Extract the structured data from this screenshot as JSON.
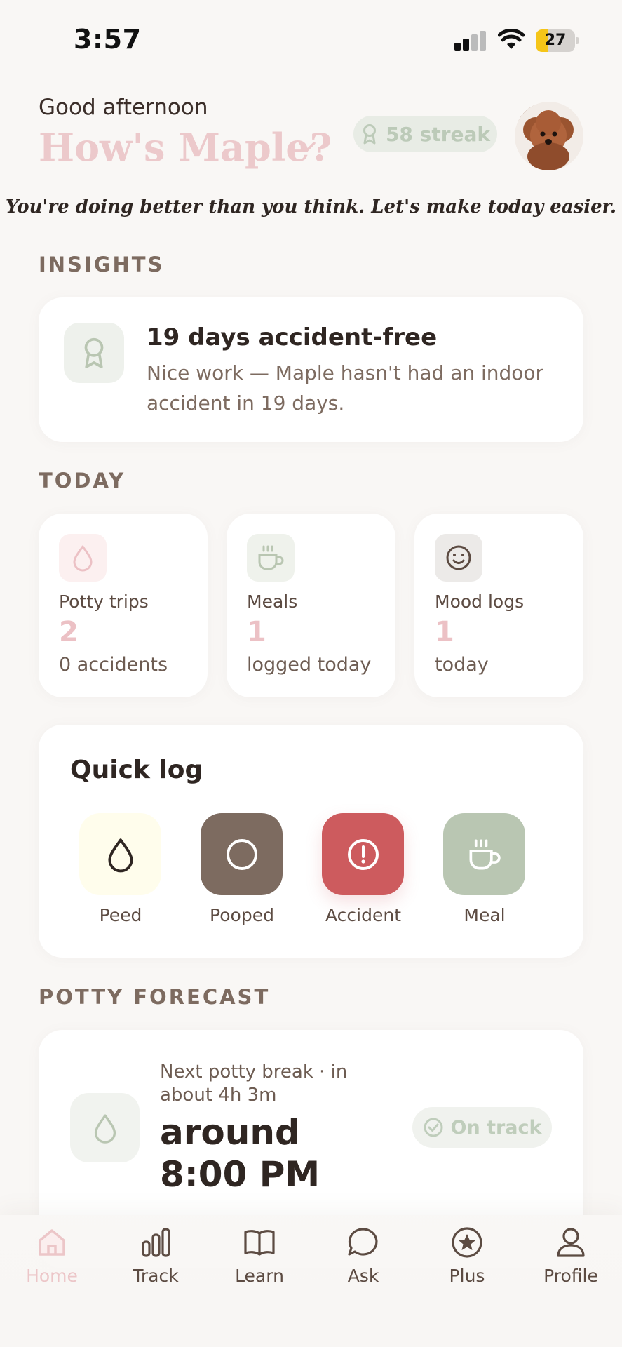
{
  "status_bar": {
    "time": "3:57",
    "battery": "27"
  },
  "header": {
    "greeting": "Good afternoon",
    "title": "How's Maple?",
    "streak": "58 streak",
    "tagline": "You're doing better than you think. Let's make today easier."
  },
  "insights": {
    "heading": "INSIGHTS",
    "card": {
      "icon": "award-icon",
      "title": "19 days accident-free",
      "body": "Nice work — Maple hasn't had an indoor accident in 19 days."
    }
  },
  "today": {
    "heading": "TODAY",
    "stats": [
      {
        "icon": "drop-icon",
        "label": "Potty trips",
        "value": "2",
        "sub": "0 accidents",
        "icon_bg": "#fcf0f0"
      },
      {
        "icon": "cup-icon",
        "label": "Meals",
        "value": "1",
        "sub": "logged today",
        "icon_bg": "#eff2ec"
      },
      {
        "icon": "smile-icon",
        "label": "Mood logs",
        "value": "1",
        "sub": "today",
        "icon_bg": "#eceae8"
      }
    ]
  },
  "quick_log": {
    "title": "Quick log",
    "buttons": [
      {
        "label": "Peed",
        "icon": "drop-icon",
        "color": "#fffdec"
      },
      {
        "label": "Pooped",
        "icon": "circle-icon",
        "color": "#7d6b60"
      },
      {
        "label": "Accident",
        "icon": "alert-icon",
        "color": "#cd5b5e"
      },
      {
        "label": "Meal",
        "icon": "cup-icon",
        "color": "#b9c6b2"
      }
    ]
  },
  "forecast": {
    "heading": "POTTY FORECAST",
    "subtitle": "Next potty break · in about 4h 3m",
    "time": "around 8:00 PM",
    "status": "On track"
  },
  "tabs": [
    {
      "label": "Home",
      "icon": "home-icon",
      "active": true
    },
    {
      "label": "Track",
      "icon": "bar-chart-icon"
    },
    {
      "label": "Learn",
      "icon": "book-icon"
    },
    {
      "label": "Ask",
      "icon": "chat-icon"
    },
    {
      "label": "Plus",
      "icon": "star-icon"
    },
    {
      "label": "Profile",
      "icon": "user-icon"
    }
  ],
  "colors": {
    "accent_pink": "#ecc1c5",
    "sage": "#b9c6b2",
    "brown": "#7d6b60",
    "danger": "#cd5b5e",
    "background": "#f9f7f5"
  }
}
